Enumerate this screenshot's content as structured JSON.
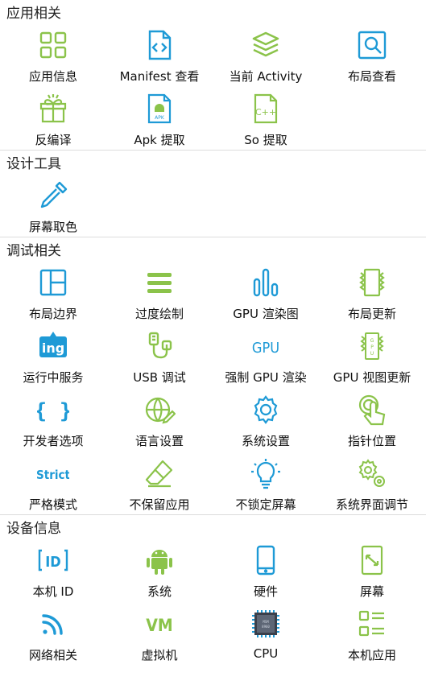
{
  "colors": {
    "green": "#8bc34a",
    "blue": "#1e9ad6",
    "section_title": "#202020",
    "divider": "#dcdcdc"
  },
  "sections": [
    {
      "title": "应用相关",
      "items": [
        {
          "label": "应用信息",
          "icon": "grid-icon"
        },
        {
          "label": "Manifest 查看",
          "icon": "code-file-icon"
        },
        {
          "label": "当前 Activity",
          "icon": "layers-icon"
        },
        {
          "label": "布局查看",
          "icon": "magnifier-icon"
        },
        {
          "label": "反编译",
          "icon": "gift-box-icon"
        },
        {
          "label": "Apk 提取",
          "icon": "apk-file-icon"
        },
        {
          "label": "So 提取",
          "icon": "cpp-file-icon"
        }
      ]
    },
    {
      "title": "设计工具",
      "items": [
        {
          "label": "屏幕取色",
          "icon": "dropper-icon"
        }
      ]
    },
    {
      "title": "调试相关",
      "items": [
        {
          "label": "布局边界",
          "icon": "layout-bounds-icon"
        },
        {
          "label": "过度绘制",
          "icon": "menu-lines-icon"
        },
        {
          "label": "GPU 渲染图",
          "icon": "bar-chart-icon"
        },
        {
          "label": "布局更新",
          "icon": "layout-update-icon"
        },
        {
          "label": "运行中服务",
          "icon": "running-service-icon",
          "icon_text": "ing"
        },
        {
          "label": "USB 调试",
          "icon": "usb-icon"
        },
        {
          "label": "强制 GPU 渲染",
          "icon": "gpu-text-icon",
          "icon_text": "GPU"
        },
        {
          "label": "GPU 视图更新",
          "icon": "gpu-view-icon"
        },
        {
          "label": "开发者选项",
          "icon": "braces-icon",
          "icon_text": "{ }"
        },
        {
          "label": "语言设置",
          "icon": "globe-icon"
        },
        {
          "label": "系统设置",
          "icon": "gear-icon"
        },
        {
          "label": "指针位置",
          "icon": "pointer-hand-icon"
        },
        {
          "label": "严格模式",
          "icon": "strict-text-icon",
          "icon_text": "Strict"
        },
        {
          "label": "不保留应用",
          "icon": "eraser-icon"
        },
        {
          "label": "不锁定屏幕",
          "icon": "lightbulb-icon"
        },
        {
          "label": "系统界面调节",
          "icon": "gears-icon"
        }
      ]
    },
    {
      "title": "设备信息",
      "items": [
        {
          "label": "本机 ID",
          "icon": "id-icon",
          "icon_text": "ID"
        },
        {
          "label": "系统",
          "icon": "android-icon"
        },
        {
          "label": "硬件",
          "icon": "phone-icon"
        },
        {
          "label": "屏幕",
          "icon": "screen-icon"
        },
        {
          "label": "网络相关",
          "icon": "wifi-icon"
        },
        {
          "label": "虚拟机",
          "icon": "vm-text-icon",
          "icon_text": "VM"
        },
        {
          "label": "CPU",
          "icon": "cpu-chip-icon"
        },
        {
          "label": "本机应用",
          "icon": "app-list-icon"
        }
      ]
    }
  ]
}
